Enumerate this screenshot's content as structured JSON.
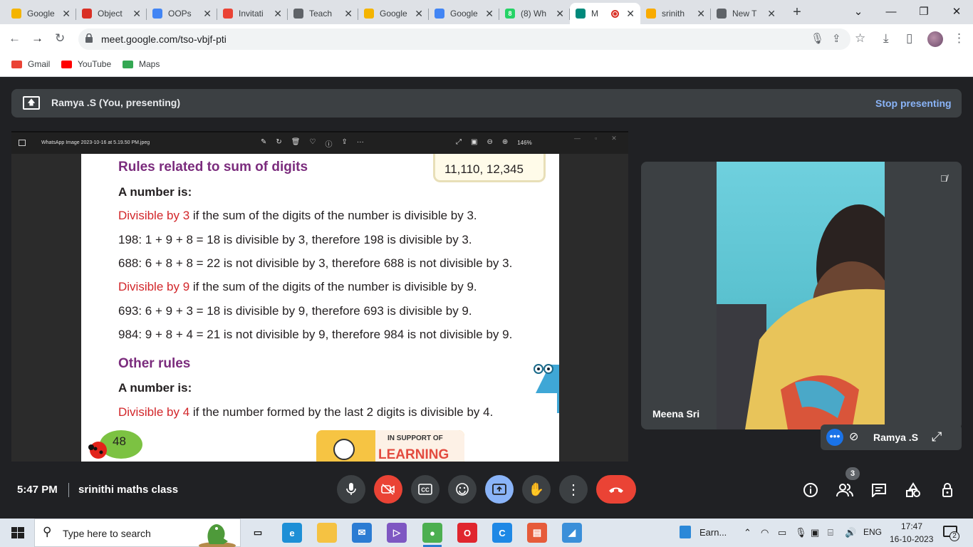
{
  "browser": {
    "tabs": [
      {
        "label": "Google",
        "icon": "google-classroom-icon",
        "color": "#f4b400"
      },
      {
        "label": "Object",
        "icon": "v-logo-icon",
        "color": "#d93025"
      },
      {
        "label": "OOPs",
        "icon": "google-icon",
        "color": "#4285f4"
      },
      {
        "label": "Invitati",
        "icon": "gmail-icon",
        "color": "#ea4335"
      },
      {
        "label": "Teach",
        "icon": "teacher-icon",
        "color": "#5f6368"
      },
      {
        "label": "Google",
        "icon": "google-classroom-icon",
        "color": "#f4b400"
      },
      {
        "label": "Google",
        "icon": "calendar-icon",
        "color": "#4285f4"
      },
      {
        "label": "(8) Wh",
        "icon": "whatsapp-icon",
        "color": "#25d366",
        "badge": "8"
      },
      {
        "label": "M",
        "icon": "meet-icon",
        "color": "#00897b",
        "active": true
      },
      {
        "label": "srinith",
        "icon": "hand-icon",
        "color": "#f9ab00"
      },
      {
        "label": "New T",
        "icon": "chrome-icon",
        "color": "#5f6368"
      }
    ],
    "url": "meet.google.com/tso-vbjf-pti",
    "bookmarks": [
      {
        "label": "Gmail",
        "icon": "gmail-icon"
      },
      {
        "label": "YouTube",
        "icon": "youtube-icon"
      },
      {
        "label": "Maps",
        "icon": "maps-icon"
      }
    ]
  },
  "meet": {
    "presenting_label": "Ramya .S (You, presenting)",
    "stop_presenting": "Stop presenting",
    "viewer": {
      "filename": "WhatsApp Image 2023-10-16 at 5.19.50 PM.jpeg",
      "zoom": "146%"
    },
    "slide": {
      "top_box": "11,110,  12,345",
      "heading1": "Rules related to sum of digits",
      "a_number_is": "A number is:",
      "line1_red": "Divisible by 3",
      "line1_rest": " if the sum of the digits of the number is divisible by 3.",
      "line2": "198: 1 + 9 + 8 = 18 is divisible by 3, therefore 198 is divisible by 3.",
      "line3": "688: 6 + 8 + 8 = 22 is not divisible by 3, therefore 688 is not divisible by 3.",
      "line4_red": "Divisible by 9",
      "line4_rest": " if the sum of the digits of the number is divisible by 9.",
      "line5": "693: 6 + 9 + 3 = 18 is divisible by 9, therefore 693 is divisible by 9.",
      "line6": "984: 9 + 8 + 4 = 21 is not divisible by 9, therefore 984 is not divisible by 9.",
      "heading2": "Other rules",
      "a_number_is2": "A number is:",
      "line7_red": "Divisible by 4",
      "line7_rest": " if the number formed by the last 2 digits is divisible by 4.",
      "page_number": "48",
      "support_label": "IN SUPPORT OF",
      "learning_label": "LEARNING"
    },
    "participant_name": "Meena Sri",
    "self_name": "Ramya .S",
    "time": "5:47 PM",
    "meeting_name": "srinithi maths class",
    "people_count": "3"
  },
  "taskbar": {
    "search_placeholder": "Type here to search",
    "earnings_label": "Earn...",
    "language": "ENG",
    "clock_time": "17:47",
    "clock_date": "16-10-2023",
    "notifications": "2"
  }
}
